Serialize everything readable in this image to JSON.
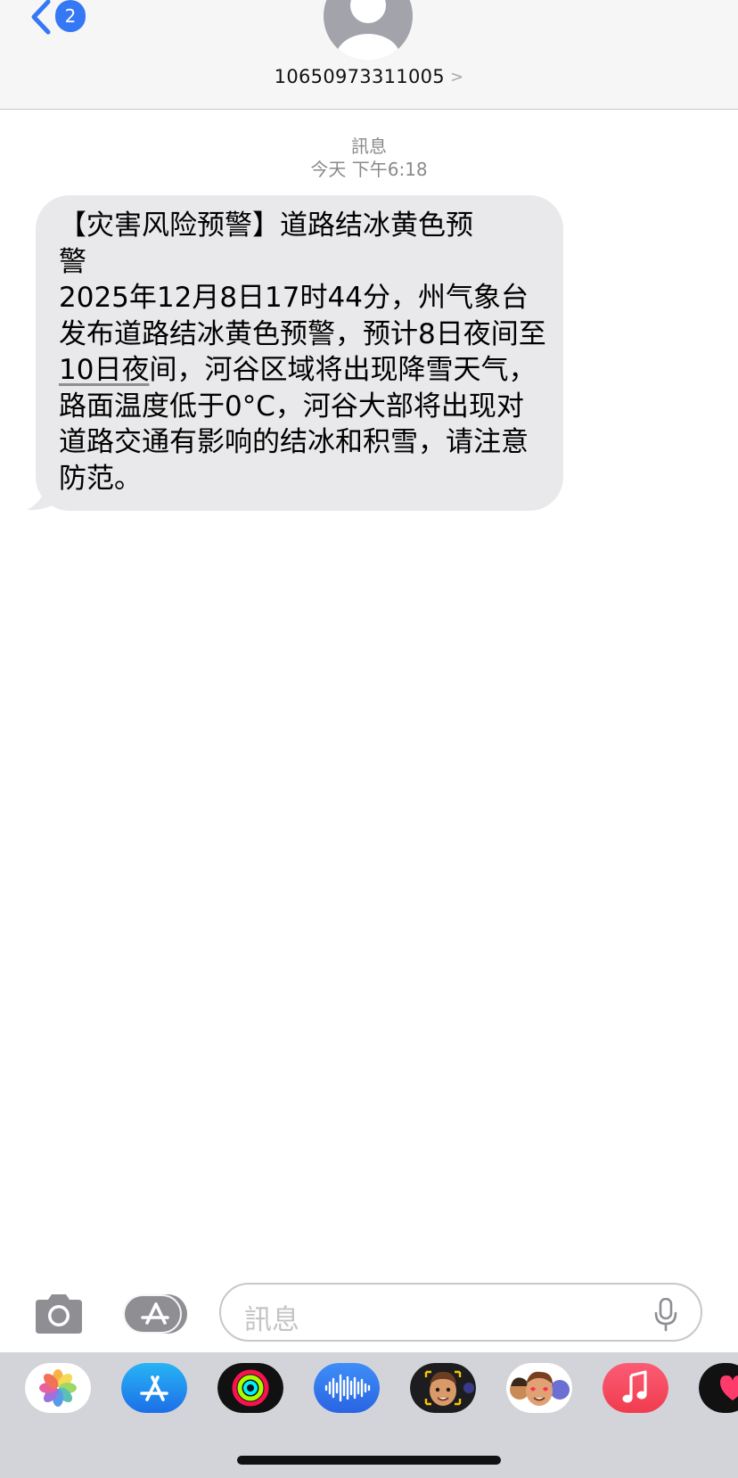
{
  "header": {
    "unread_count": "2",
    "contact_number": "10650973311005",
    "contact_chevron": ">"
  },
  "conversation": {
    "service_label": "訊息",
    "timestamp": "今天 下午6:18",
    "message": {
      "line1": "【灾害风险预警】道路结冰黄色预",
      "line2": "警",
      "body_pre": "2025年12月8日17时44分，州气象台发布道路结冰黄色预警，预计8日夜间至",
      "body_link": "10日夜",
      "body_post": "间，河谷区域将出现降雪天气，路面温度低于0°C，河谷大部将出现对道路交通有影响的结冰和积雪，请注意防范。"
    }
  },
  "composer": {
    "placeholder": "訊息"
  },
  "app_drawer": {
    "apps": [
      {
        "name": "photos-app-icon"
      },
      {
        "name": "app-store-app-icon"
      },
      {
        "name": "fitness-app-icon"
      },
      {
        "name": "audio-message-app-icon"
      },
      {
        "name": "memoji-app-icon"
      },
      {
        "name": "memoji-stickers-app-icon"
      },
      {
        "name": "music-app-icon"
      },
      {
        "name": "digital-touch-app-icon"
      }
    ]
  },
  "colors": {
    "accent_blue": "#3478f6",
    "bubble_gray": "#e9e9eb",
    "drawer_bg": "#d2d4da",
    "music_red": "#f5435a"
  }
}
